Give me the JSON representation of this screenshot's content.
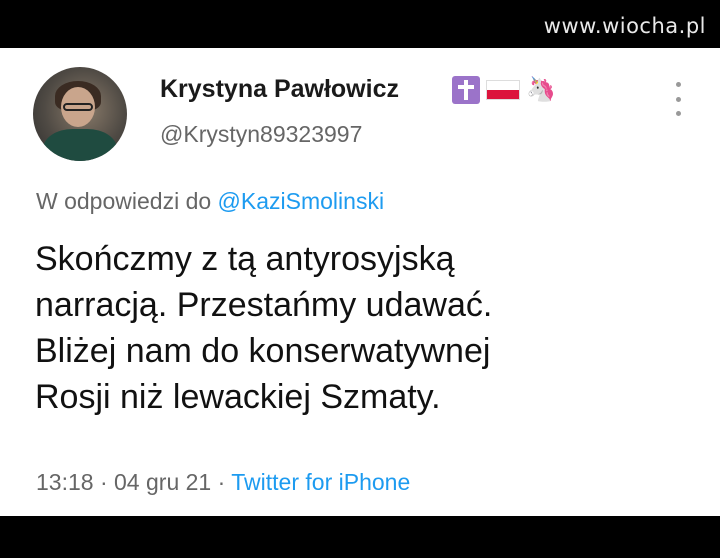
{
  "watermark": "www.wiocha.pl",
  "tweet": {
    "author_name": "Krystyna Pawłowicz",
    "handle": "@Krystyn89323997",
    "badges": [
      "cross-icon",
      "polish-flag-icon",
      "unicorn-icon"
    ],
    "reply_prefix": "W odpowiedzi do",
    "reply_mention": "@KaziSmolinski",
    "text_lines": [
      "Skończmy z tą antyrosyjską",
      "narracją. Przestańmy udawać.",
      "Bliżej nam do konserwatywnej",
      "Rosji niż lewackiej Szmaty."
    ],
    "time": "13:18",
    "separator": "·",
    "date": "04 gru 21",
    "source": "Twitter for iPhone"
  },
  "colors": {
    "link": "#1d9bf0",
    "secondary_text": "#666666",
    "flag_red": "#dc143c",
    "cross_badge": "#9b73c9"
  }
}
